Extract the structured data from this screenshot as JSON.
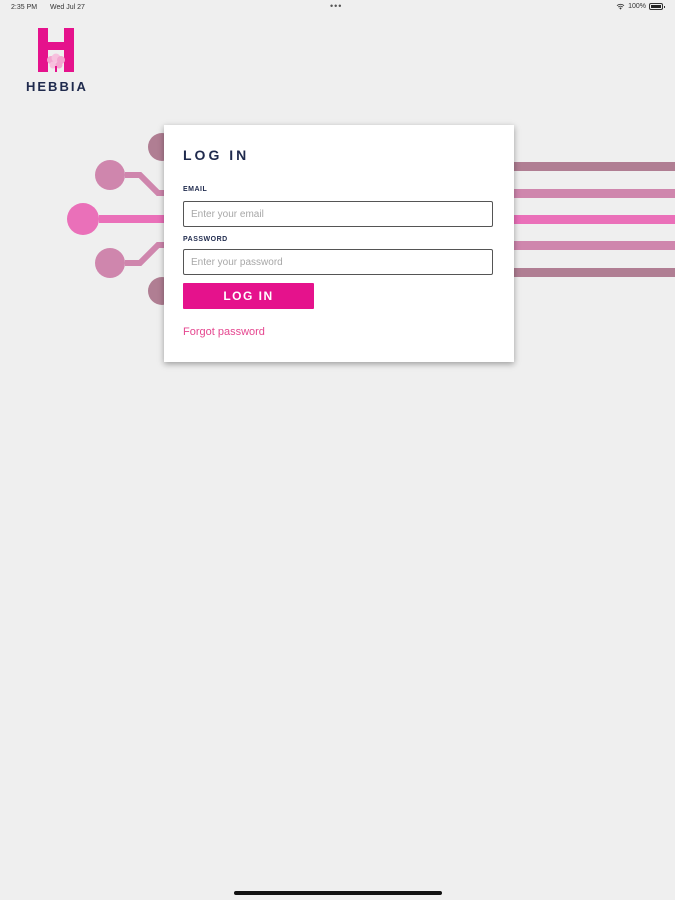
{
  "status_bar": {
    "time": "2:35 PM",
    "date": "Wed Jul 27",
    "dots": "•••",
    "battery": "100%"
  },
  "logo": {
    "text": "HEBBIA"
  },
  "login": {
    "title": "LOG IN",
    "email_label": "EMAIL",
    "email_placeholder": "Enter your email",
    "password_label": "PASSWORD",
    "password_placeholder": "Enter your password",
    "button_label": "LOG IN",
    "forgot_label": "Forgot password"
  },
  "colors": {
    "brand_pink": "#e5128c",
    "link_pink": "#e5468f",
    "navy": "#1f2a4d",
    "circuit_light": "#cf86ad",
    "circuit_dark": "#b07e93",
    "circuit_bright": "#ea70b9"
  }
}
